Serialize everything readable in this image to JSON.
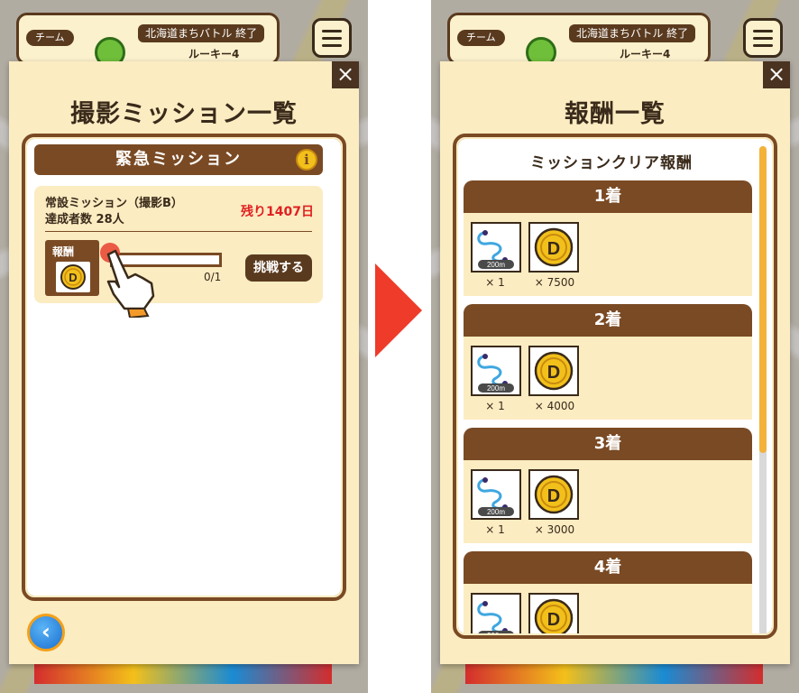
{
  "left_screen": {
    "header": {
      "team_tab": "チーム",
      "battle_title": "北海道まちバトル 終了",
      "rank": "ルーキー4"
    },
    "modal": {
      "title": "撮影ミッション一覧",
      "urgent_label": "緊急ミッション",
      "info_icon": "i",
      "mission": {
        "name": "常設ミッション（撮影B）",
        "achievers": "達成者数 28人",
        "remaining": "残り1407日",
        "reward_label": "報酬",
        "progress_text": "0/1",
        "progress": 0,
        "challenge_button": "挑戦する"
      },
      "close": "×",
      "back": "‹"
    }
  },
  "right_screen": {
    "header": {
      "team_tab": "チーム",
      "battle_title": "北海道まちバトル 終了",
      "rank": "ルーキー4"
    },
    "modal": {
      "title": "報酬一覧",
      "subtitle": "ミッションクリア報酬",
      "close": "×",
      "ranks": [
        {
          "label": "1着",
          "route_qty": "× 1",
          "coin_qty": "× 7500"
        },
        {
          "label": "2着",
          "route_qty": "× 1",
          "coin_qty": "× 4000"
        },
        {
          "label": "3着",
          "route_qty": "× 1",
          "coin_qty": "× 3000"
        },
        {
          "label": "4着",
          "route_qty": "",
          "coin_qty": ""
        }
      ],
      "route_tile_label": "200m",
      "coin_letter": "D"
    }
  },
  "colors": {
    "panel": "#fbecc2",
    "frame_brown": "#7a4a24",
    "coin_gold": "#f2c01a",
    "red_text": "#e02020",
    "arrow_red": "#ee3b2a"
  }
}
